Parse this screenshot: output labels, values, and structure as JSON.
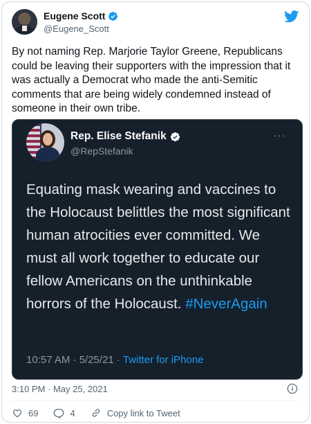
{
  "tweet": {
    "author": {
      "name": "Eugene Scott",
      "handle": "@Eugene_Scott",
      "verified": true
    },
    "text": "By not naming Rep. Marjorie Taylor Greene, Republicans could be leaving their supporters with the impression that it was actually a Democrat who made the anti-Semitic comments that are being widely condemned instead of someone in their own tribe.",
    "timestamp": "3:10 PM · May 25, 2021",
    "likes": "69",
    "replies": "4",
    "copy_link_label": "Copy link to Tweet"
  },
  "quoted": {
    "author": {
      "name": "Rep. Elise Stefanik",
      "handle": "@RepStefanik",
      "verified": true
    },
    "text": "Equating mask wearing and vaccines to the Holocaust belittles the most significant human atrocities ever committed. We must all work together to educate our fellow Americans on the unthinkable horrors of the Holocaust.",
    "hashtag": "#NeverAgain",
    "time": "10:57 AM · 5/25/21 · ",
    "source": "Twitter for iPhone",
    "more": "···"
  },
  "colors": {
    "twitter_blue": "#1d9bf0",
    "quote_bg": "#15202b",
    "muted": "#536471"
  },
  "icons": [
    "twitter-bird-icon",
    "verified-badge-icon",
    "heart-icon",
    "reply-icon",
    "link-icon",
    "info-icon",
    "more-icon"
  ]
}
